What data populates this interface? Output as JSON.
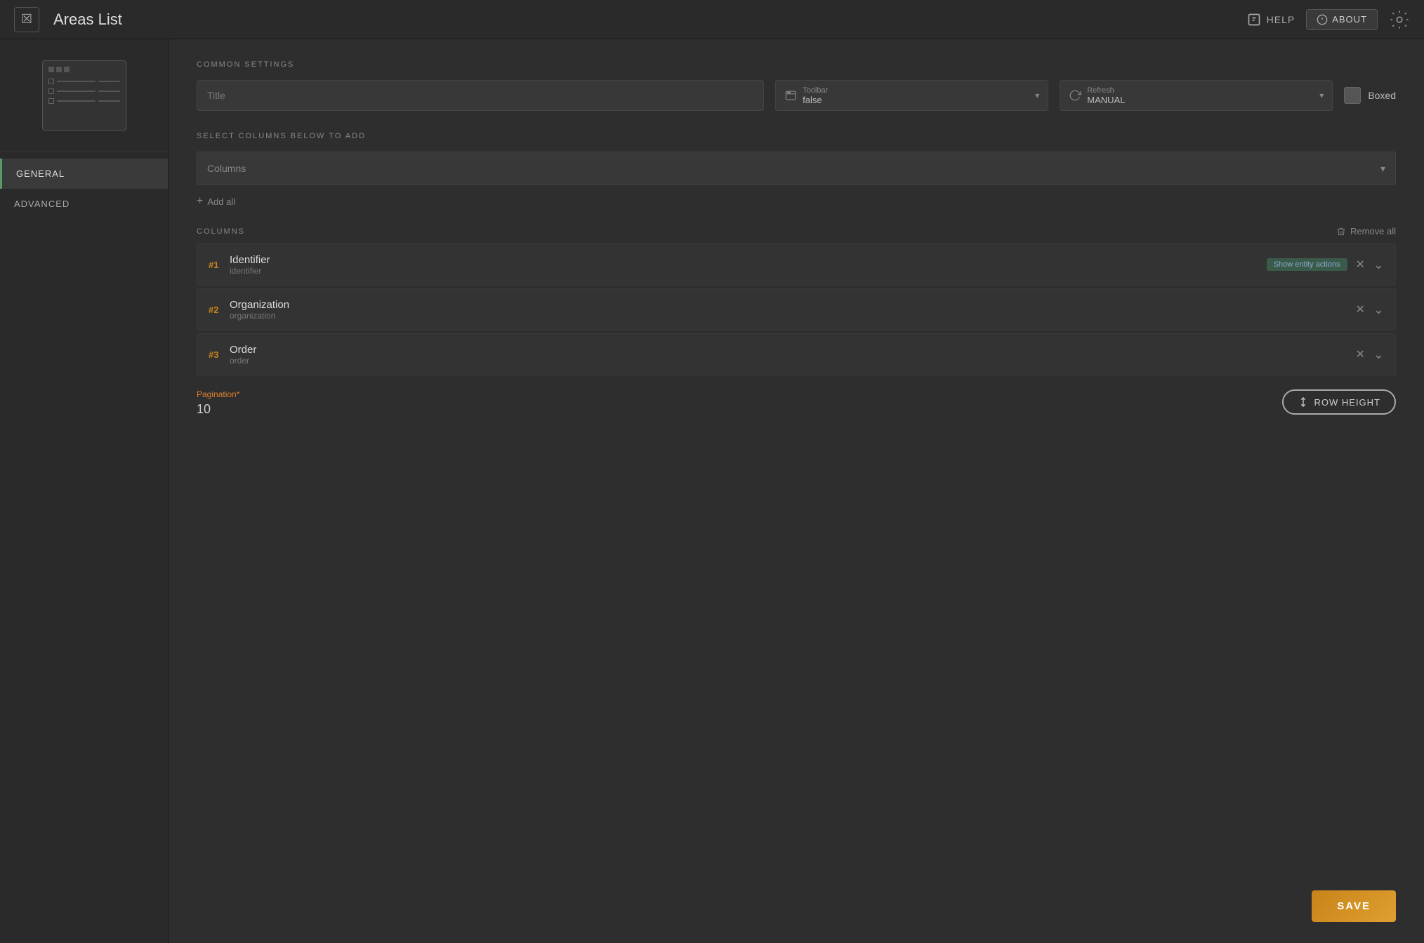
{
  "header": {
    "title": "Areas List",
    "close_icon": "×",
    "help_label": "HELP",
    "about_label": "ABOUT"
  },
  "sidebar": {
    "nav_items": [
      {
        "id": "general",
        "label": "GENERAL",
        "active": true
      },
      {
        "id": "advanced",
        "label": "ADVANCED",
        "active": false
      }
    ]
  },
  "common_settings": {
    "section_label": "COMMON SETTINGS",
    "title_placeholder": "Title",
    "toolbar_label": "Toolbar",
    "toolbar_value": "false",
    "refresh_label": "Refresh",
    "refresh_value": "MANUAL",
    "boxed_label": "Boxed"
  },
  "columns_section": {
    "select_label": "SELECT COLUMNS BELOW TO ADD",
    "columns_placeholder": "Columns",
    "add_all_label": "Add all",
    "columns_header": "COLUMNS",
    "remove_all_label": "Remove all",
    "columns": [
      {
        "num": "#1",
        "name": "Identifier",
        "key": "identifier",
        "badge": "Show entity actions"
      },
      {
        "num": "#2",
        "name": "Organization",
        "key": "organization",
        "badge": null
      },
      {
        "num": "#3",
        "name": "Order",
        "key": "order",
        "badge": null
      }
    ]
  },
  "pagination": {
    "label": "Pagination",
    "required": "*",
    "value": "10"
  },
  "row_height": {
    "label": "ROW HEIGHT"
  },
  "save_button": {
    "label": "SAVE"
  }
}
